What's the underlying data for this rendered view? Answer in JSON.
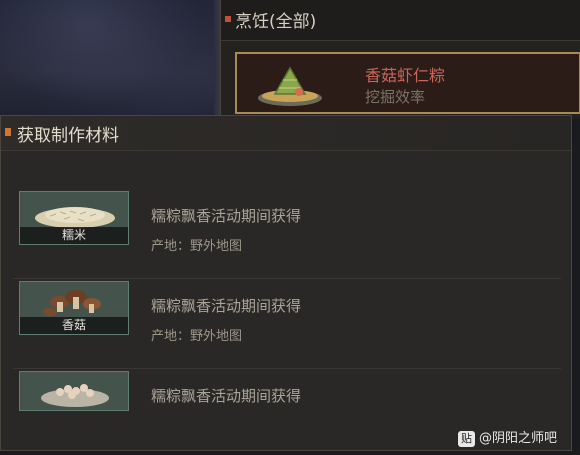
{
  "cooking_panel": {
    "title": "烹饪(全部)",
    "recipe": {
      "name": "香菇虾仁粽",
      "effect": "挖掘效率"
    }
  },
  "dialog": {
    "title": "获取制作材料",
    "items": [
      {
        "name": "糯米",
        "source": "糯粽飘香活动期间获得",
        "origin": "产地：野外地图",
        "icon": "rice-icon"
      },
      {
        "name": "香菇",
        "source": "糯粽飘香活动期间获得",
        "origin": "产地：野外地图",
        "icon": "mushroom-icon"
      },
      {
        "name": "",
        "source": "糯粽飘香活动期间获得",
        "origin": "",
        "icon": "shrimp-icon"
      }
    ]
  },
  "watermark": {
    "badge": "贴",
    "text": "@阴阳之师吧"
  },
  "colors": {
    "accent": "#d0762e",
    "card_border": "#a88a57",
    "recipe_name": "#c8665a"
  }
}
